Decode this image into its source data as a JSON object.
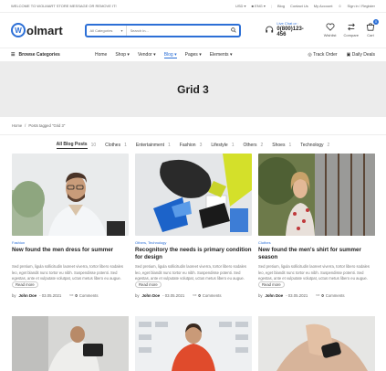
{
  "topbar": {
    "welcome": "WELCOME TO WOLMART STORE MESSAGE OR REMOVE IT!",
    "currency": "USD",
    "language": "ENG",
    "links": [
      "Blog",
      "Contact Us",
      "My Account",
      "Sign in / Register"
    ]
  },
  "header": {
    "logo": "olmart",
    "logo_mark": "W",
    "search_category": "All Categories",
    "search_placeholder": "Search in...",
    "live_label": "Live Chat or :",
    "phone": "0(800)123-456",
    "icons": [
      {
        "label": "Wishlist",
        "icon": "heart-icon"
      },
      {
        "label": "Compare",
        "icon": "compare-icon"
      },
      {
        "label": "Cart",
        "icon": "cart-icon",
        "badge": "0"
      }
    ]
  },
  "nav": {
    "browse": "Browse Categories",
    "items": [
      "Home",
      "Shop",
      "Vendor",
      "Blog",
      "Pages",
      "Elements"
    ],
    "active": "Blog",
    "right": [
      "Track Order",
      "Daily Deals"
    ]
  },
  "banner": {
    "title": "Grid 3"
  },
  "breadcrumb": {
    "home": "Home",
    "current": "Posts tagged \"Grid 3\""
  },
  "filters": [
    {
      "label": "All Blog Posts",
      "count": "10",
      "active": true
    },
    {
      "label": "Clothes",
      "count": "1"
    },
    {
      "label": "Entertainment",
      "count": "1"
    },
    {
      "label": "Fashion",
      "count": "3"
    },
    {
      "label": "Lifestyle",
      "count": "1"
    },
    {
      "label": "Others",
      "count": "2"
    },
    {
      "label": "Shoes",
      "count": "1"
    },
    {
      "label": "Technology",
      "count": "2"
    }
  ],
  "posts": [
    {
      "category": "Fashion",
      "title": "New found the men dress for summer",
      "excerpt": "Sed pretium, ligula sollicitudin laoreet viverra, tortor libero sodales leo, eget blandit nunc tortor eu nibh. Suspendisse potenti. Sed egestas, ante et vulputate volutpat, uctus metus libero eu augue.",
      "read_more": "Read more",
      "by": "by",
      "author": "John Doe",
      "date": "- 03.05.2021",
      "comments": "0",
      "comments_label": "Comments"
    },
    {
      "category": "Others, Technology",
      "title": "Recognitory the needs is primary condition for design",
      "excerpt": "Sed pretium, ligula sollicitudin laoreet viverra, tortor libero sodales leo, eget blandit nunc tortor eu nibh. Suspendisse potenti. Sed egestas, ante et vulputate volutpat, uctus metus libero eu augue.",
      "read_more": "Read more",
      "by": "by",
      "author": "John Doe",
      "date": "- 03.05.2021",
      "comments": "0",
      "comments_label": "Comments"
    },
    {
      "category": "Clothes",
      "title": "New found the men's shirt for summer season",
      "excerpt": "Sed pretium, ligula sollicitudin laoreet viverra, tortor libero sodales leo, eget blandit nunc tortor eu nibh. Suspendisse potenti. Sed egestas, ante et vulputate volutpat, uctus metus libero eu augue.",
      "read_more": "Read more",
      "by": "by",
      "author": "John Doe",
      "date": "- 03.05.2021",
      "comments": "0",
      "comments_label": "Comments"
    }
  ],
  "colors": {
    "accent": "#2c6fd6",
    "banner": "#ececec"
  }
}
